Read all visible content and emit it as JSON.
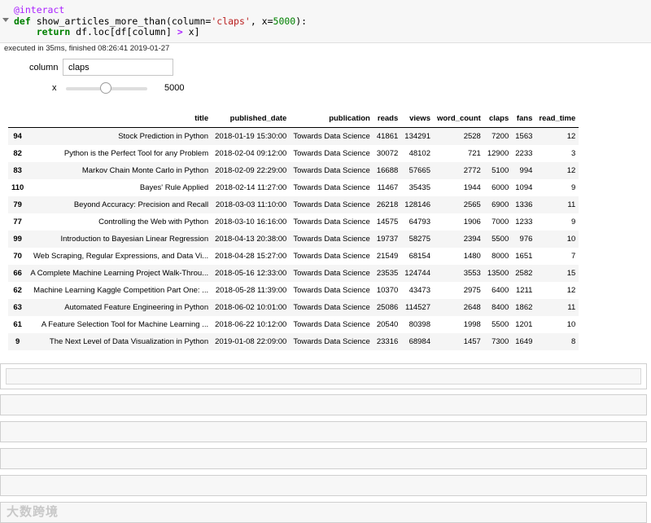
{
  "code_cell": {
    "lines": {
      "l1_decorator": "@interact",
      "l2_def": "def",
      "l2_name": " show_articles_more_than(column=",
      "l2_str": "'claps'",
      "l2_mid": ", x=",
      "l2_num": "5000",
      "l2_end": "):",
      "l3_indent": "    ",
      "l3_return": "return",
      "l3_a": " df.loc[df[column] ",
      "l3_op": ">",
      "l3_b": " x]"
    },
    "exec_status": "executed in 35ms, finished 08:26:41 2019-01-27"
  },
  "widgets": {
    "column_label": "column",
    "column_value": "claps",
    "x_label": "x",
    "x_value": "5000",
    "x_slider_fraction": 0.5
  },
  "table": {
    "columns": [
      "title",
      "published_date",
      "publication",
      "reads",
      "views",
      "word_count",
      "claps",
      "fans",
      "read_time"
    ],
    "rows": [
      {
        "index": "94",
        "title": "Stock Prediction in Python",
        "published_date": "2018-01-19 15:30:00",
        "publication": "Towards Data Science",
        "reads": "41861",
        "views": "134291",
        "word_count": "2528",
        "claps": "7200",
        "fans": "1563",
        "read_time": "12"
      },
      {
        "index": "82",
        "title": "Python is the Perfect Tool for any Problem",
        "published_date": "2018-02-04 09:12:00",
        "publication": "Towards Data Science",
        "reads": "30072",
        "views": "48102",
        "word_count": "721",
        "claps": "12900",
        "fans": "2233",
        "read_time": "3"
      },
      {
        "index": "83",
        "title": "Markov Chain Monte Carlo in Python",
        "published_date": "2018-02-09 22:29:00",
        "publication": "Towards Data Science",
        "reads": "16688",
        "views": "57665",
        "word_count": "2772",
        "claps": "5100",
        "fans": "994",
        "read_time": "12"
      },
      {
        "index": "110",
        "title": "Bayes' Rule Applied",
        "published_date": "2018-02-14 11:27:00",
        "publication": "Towards Data Science",
        "reads": "11467",
        "views": "35435",
        "word_count": "1944",
        "claps": "6000",
        "fans": "1094",
        "read_time": "9"
      },
      {
        "index": "79",
        "title": "Beyond Accuracy: Precision and Recall",
        "published_date": "2018-03-03 11:10:00",
        "publication": "Towards Data Science",
        "reads": "26218",
        "views": "128146",
        "word_count": "2565",
        "claps": "6900",
        "fans": "1336",
        "read_time": "11"
      },
      {
        "index": "77",
        "title": "Controlling the Web with Python",
        "published_date": "2018-03-10 16:16:00",
        "publication": "Towards Data Science",
        "reads": "14575",
        "views": "64793",
        "word_count": "1906",
        "claps": "7000",
        "fans": "1233",
        "read_time": "9"
      },
      {
        "index": "99",
        "title": "Introduction to Bayesian Linear Regression",
        "published_date": "2018-04-13 20:38:00",
        "publication": "Towards Data Science",
        "reads": "19737",
        "views": "58275",
        "word_count": "2394",
        "claps": "5500",
        "fans": "976",
        "read_time": "10"
      },
      {
        "index": "70",
        "title": "Web Scraping, Regular Expressions, and Data Vi...",
        "published_date": "2018-04-28 15:27:00",
        "publication": "Towards Data Science",
        "reads": "21549",
        "views": "68154",
        "word_count": "1480",
        "claps": "8000",
        "fans": "1651",
        "read_time": "7"
      },
      {
        "index": "66",
        "title": "A Complete Machine Learning Project Walk-Throu...",
        "published_date": "2018-05-16 12:33:00",
        "publication": "Towards Data Science",
        "reads": "23535",
        "views": "124744",
        "word_count": "3553",
        "claps": "13500",
        "fans": "2582",
        "read_time": "15"
      },
      {
        "index": "62",
        "title": "Machine Learning Kaggle Competition Part One: ...",
        "published_date": "2018-05-28 11:39:00",
        "publication": "Towards Data Science",
        "reads": "10370",
        "views": "43473",
        "word_count": "2975",
        "claps": "6400",
        "fans": "1211",
        "read_time": "12"
      },
      {
        "index": "63",
        "title": "Automated Feature Engineering in Python",
        "published_date": "2018-06-02 10:01:00",
        "publication": "Towards Data Science",
        "reads": "25086",
        "views": "114527",
        "word_count": "2648",
        "claps": "8400",
        "fans": "1862",
        "read_time": "11"
      },
      {
        "index": "61",
        "title": "A Feature Selection Tool for Machine Learning ...",
        "published_date": "2018-06-22 10:12:00",
        "publication": "Towards Data Science",
        "reads": "20540",
        "views": "80398",
        "word_count": "1998",
        "claps": "5500",
        "fans": "1201",
        "read_time": "10"
      },
      {
        "index": "9",
        "title": "The Next Level of Data Visualization in Python",
        "published_date": "2019-01-08 22:09:00",
        "publication": "Towards Data Science",
        "reads": "23316",
        "views": "68984",
        "word_count": "1457",
        "claps": "7300",
        "fans": "1649",
        "read_time": "8"
      }
    ]
  },
  "watermark": "大数跨境"
}
